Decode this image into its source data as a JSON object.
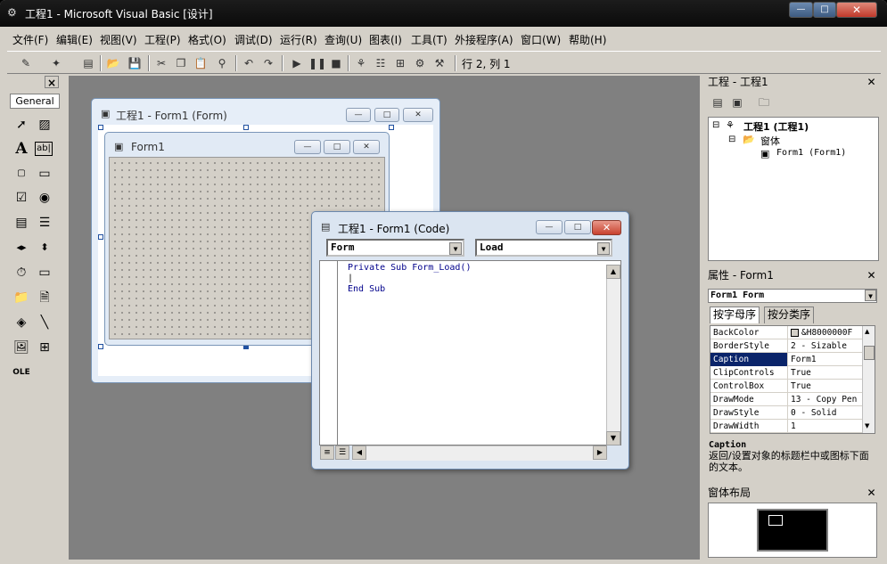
{
  "window": {
    "title": "工程1 - Microsoft Visual Basic [设计]"
  },
  "caption_buttons": {
    "min": "—",
    "max": "□",
    "close": "✕"
  },
  "menu": [
    "文件(F)",
    "编辑(E)",
    "视图(V)",
    "工程(P)",
    "格式(O)",
    "调试(D)",
    "运行(R)",
    "查询(U)",
    "图表(I)",
    "工具(T)",
    "外接程序(A)",
    "窗口(W)",
    "帮助(H)"
  ],
  "toolbar": {
    "cursor_position": "行 2, 列 1"
  },
  "toolbox": {
    "tab_label": "General",
    "close": "×"
  },
  "form_designer": {
    "title": "工程1 - Form1 (Form)"
  },
  "form1": {
    "title": "Form1"
  },
  "code_window": {
    "title": "工程1 - Form1 (Code)",
    "object_combo": "Form",
    "procedure_combo": "Load",
    "lines": [
      "Private Sub Form_Load()",
      "|",
      "End Sub"
    ]
  },
  "project_panel": {
    "title": "工程 - 工程1",
    "tree": {
      "root": "工程1 (工程1)",
      "folder": "窗体",
      "item": "Form1 (Form1)"
    }
  },
  "properties_panel": {
    "title": "属性 - Form1",
    "object": "Form1 Form",
    "tabs": [
      "按字母序",
      "按分类序"
    ],
    "rows": [
      {
        "name": "BackColor",
        "value": "&H8000000F"
      },
      {
        "name": "BorderStyle",
        "value": "2 - Sizable"
      },
      {
        "name": "Caption",
        "value": "Form1"
      },
      {
        "name": "ClipControls",
        "value": "True"
      },
      {
        "name": "ControlBox",
        "value": "True"
      },
      {
        "name": "DrawMode",
        "value": "13 - Copy Pen"
      },
      {
        "name": "DrawStyle",
        "value": "0 - Solid"
      },
      {
        "name": "DrawWidth",
        "value": "1"
      }
    ],
    "selected": "Caption",
    "description_title": "Caption",
    "description_text": "返回/设置对象的标题栏中或图标下面的文本。"
  },
  "layout_panel": {
    "title": "窗体布局"
  },
  "colors": {
    "selection": "#0a246a",
    "titlebar": "#0a0a0a",
    "mdi": "#808080"
  }
}
